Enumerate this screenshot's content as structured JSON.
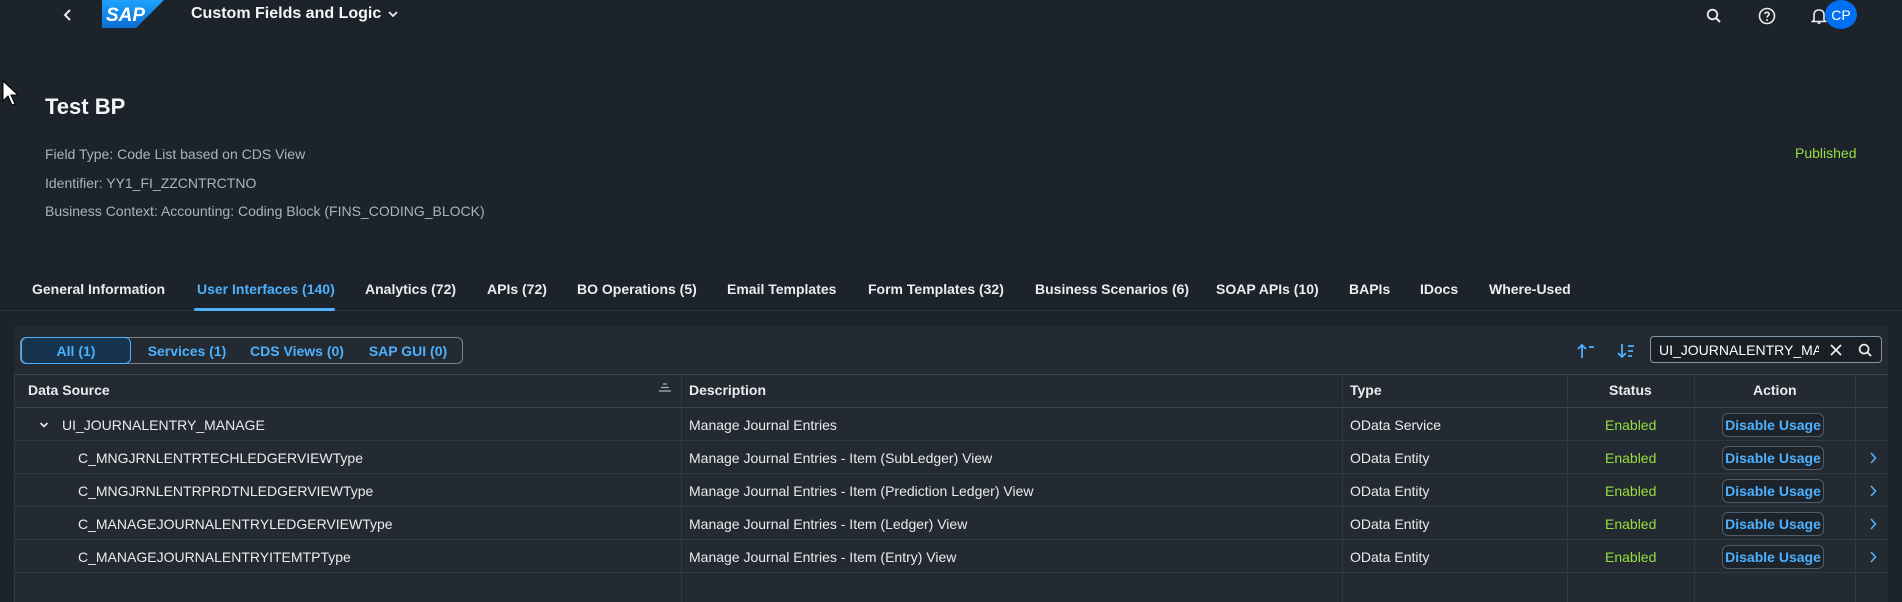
{
  "shell": {
    "logo_text": "SAP",
    "app_title": "Custom Fields and Logic",
    "avatar_initials": "CP"
  },
  "header": {
    "title": "Test BP",
    "field_type": "Field Type: Code List based on CDS View",
    "identifier": "Identifier: YY1_FI_ZZCNTRCTNO",
    "business_context": "Business Context: Accounting: Coding Block (FINS_CODING_BLOCK)",
    "status": "Published"
  },
  "tabs": [
    {
      "label": "General Information"
    },
    {
      "label": "User Interfaces (140)"
    },
    {
      "label": "Analytics (72)"
    },
    {
      "label": "APIs (72)"
    },
    {
      "label": "BO Operations (5)"
    },
    {
      "label": "Email Templates"
    },
    {
      "label": "Form Templates (32)"
    },
    {
      "label": "Business Scenarios (6)"
    },
    {
      "label": "SOAP APIs (10)"
    },
    {
      "label": "BAPIs"
    },
    {
      "label": "IDocs"
    },
    {
      "label": "Where-Used"
    }
  ],
  "segments": [
    {
      "label": "All (1)"
    },
    {
      "label": "Services (1)"
    },
    {
      "label": "CDS Views (0)"
    },
    {
      "label": "SAP GUI (0)"
    }
  ],
  "search": {
    "value": "UI_JOURNALENTRY_MANAGE"
  },
  "table": {
    "columns": [
      "Data Source",
      "Description",
      "Type",
      "Status",
      "Action"
    ],
    "rows": [
      {
        "source": "UI_JOURNALENTRY_MANAGE",
        "description": "Manage Journal Entries",
        "type": "OData Service",
        "status": "Enabled",
        "action": "Disable Usage"
      },
      {
        "source": "C_MNGJRNLENTRTECHLEDGERVIEWType",
        "description": "Manage Journal Entries - Item (SubLedger) View",
        "type": "OData Entity",
        "status": "Enabled",
        "action": "Disable Usage"
      },
      {
        "source": "C_MNGJRNLENTRPRDTNLEDGERVIEWType",
        "description": "Manage Journal Entries - Item (Prediction Ledger) View",
        "type": "OData Entity",
        "status": "Enabled",
        "action": "Disable Usage"
      },
      {
        "source": "C_MANAGEJOURNALENTRYLEDGERVIEWType",
        "description": "Manage Journal Entries - Item (Ledger) View",
        "type": "OData Entity",
        "status": "Enabled",
        "action": "Disable Usage"
      },
      {
        "source": "C_MANAGEJOURNALENTRYITEMTPType",
        "description": "Manage Journal Entries - Item (Entry) View",
        "type": "OData Entity",
        "status": "Enabled",
        "action": "Disable Usage"
      }
    ]
  },
  "colors": {
    "background": "#1d232a",
    "accent": "#4db1ff",
    "success": "#97dd40",
    "avatar": "#0070f2"
  }
}
